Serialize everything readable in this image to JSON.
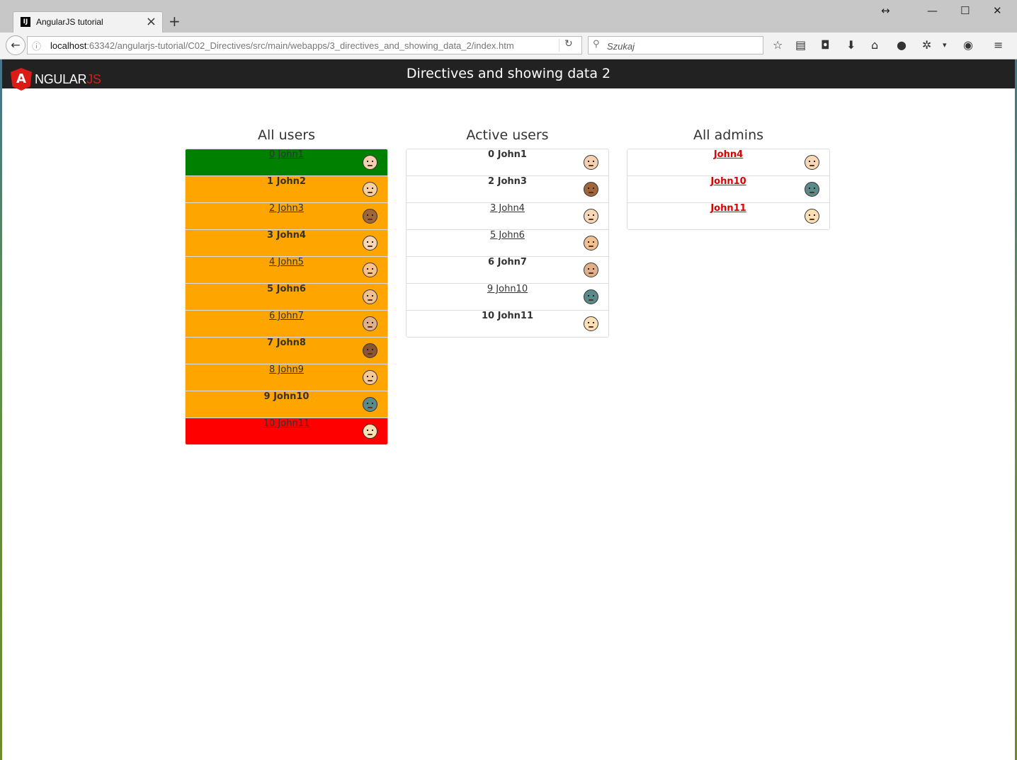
{
  "browser": {
    "tab_title": "AngularJS tutorial",
    "tab_favicon": "IJ",
    "url_host": "localhost",
    "url_rest": ":63342/angularjs-tutorial/C02_Directives/src/main/webapps/3_directives_and_showing_data_2/index.htm",
    "search_placeholder": "Szukaj",
    "icons": [
      "back-arrow-icon",
      "info-icon",
      "reload-icon",
      "search-icon",
      "star-icon",
      "reading-list-icon",
      "pocket-icon",
      "download-icon",
      "home-icon",
      "chat-icon",
      "extension-icon",
      "dropdown-icon",
      "ghost-icon",
      "hamburger-menu-icon"
    ]
  },
  "header": {
    "logo_shield": "A",
    "logo_text_main": "NGULAR",
    "logo_text_js": "JS",
    "title": "Directives and showing data 2"
  },
  "columns": {
    "all_users": {
      "title": "All users",
      "items": [
        {
          "label": "0 John1",
          "style": "link",
          "bg": "#008000",
          "avatar": "#f5d0b0"
        },
        {
          "label": "1 John2",
          "style": "bold",
          "bg": "#ffa500",
          "avatar": "#f8cfa0"
        },
        {
          "label": "2 John3",
          "style": "link",
          "bg": "#ffa500",
          "avatar": "#a0663a"
        },
        {
          "label": "3 John4",
          "style": "bold",
          "bg": "#ffa500",
          "avatar": "#f7d7b5"
        },
        {
          "label": "4 John5",
          "style": "link",
          "bg": "#ffa500",
          "avatar": "#f9c08a"
        },
        {
          "label": "5 John6",
          "style": "bold",
          "bg": "#ffa500",
          "avatar": "#f0c090"
        },
        {
          "label": "6 John7",
          "style": "link",
          "bg": "#ffa500",
          "avatar": "#e0b08a"
        },
        {
          "label": "7 John8",
          "style": "bold",
          "bg": "#ffa500",
          "avatar": "#8a5530"
        },
        {
          "label": "8 John9",
          "style": "link",
          "bg": "#ffa500",
          "avatar": "#f3c99a"
        },
        {
          "label": "9 John10",
          "style": "bold",
          "bg": "#ffa500",
          "avatar": "#5a8a8a"
        },
        {
          "label": "10 John11",
          "style": "link",
          "bg": "#ff0000",
          "avatar": "#fbe0b5"
        }
      ]
    },
    "active_users": {
      "title": "Active users",
      "items": [
        {
          "label": "0 John1",
          "style": "bold",
          "bg": "#ffffff",
          "avatar": "#f5d0b0"
        },
        {
          "label": "2 John3",
          "style": "bold",
          "bg": "#ffffff",
          "avatar": "#a0663a"
        },
        {
          "label": "3 John4",
          "style": "link",
          "bg": "#ffffff",
          "avatar": "#f7d7b5"
        },
        {
          "label": "5 John6",
          "style": "link",
          "bg": "#ffffff",
          "avatar": "#f0c090"
        },
        {
          "label": "6 John7",
          "style": "bold",
          "bg": "#ffffff",
          "avatar": "#e0b08a"
        },
        {
          "label": "9 John10",
          "style": "link",
          "bg": "#ffffff",
          "avatar": "#5a8a8a"
        },
        {
          "label": "10 John11",
          "style": "bold",
          "bg": "#ffffff",
          "avatar": "#fbe0b5"
        }
      ]
    },
    "all_admins": {
      "title": "All admins",
      "items": [
        {
          "label": "John4",
          "style": "admin",
          "bg": "#ffffff",
          "avatar": "#f7d7b5"
        },
        {
          "label": "John10",
          "style": "admin",
          "bg": "#ffffff",
          "avatar": "#5a8a8a"
        },
        {
          "label": "John11",
          "style": "admin",
          "bg": "#ffffff",
          "avatar": "#fbe0b5"
        }
      ]
    }
  }
}
